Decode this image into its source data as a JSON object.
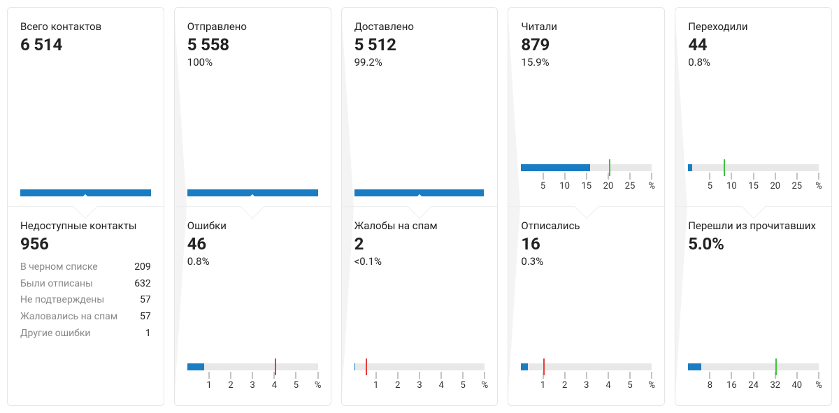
{
  "columns": [
    {
      "top": {
        "title": "Всего контактов",
        "value": "6 514",
        "bar": {
          "fill_pct": 100
        }
      },
      "bottom": {
        "title": "Недоступные контакты",
        "value": "956",
        "items": [
          {
            "label": "В черном списке",
            "value": "209"
          },
          {
            "label": "Были отписаны",
            "value": "632"
          },
          {
            "label": "Не подтверждены",
            "value": "57"
          },
          {
            "label": "Жаловались на спам",
            "value": "57"
          },
          {
            "label": "Другие ошибки",
            "value": "1"
          }
        ]
      }
    },
    {
      "top": {
        "title": "Отправлено",
        "value": "5 558",
        "percent": "100%",
        "bar": {
          "fill_pct": 100
        }
      },
      "bottom": {
        "title": "Ошибки",
        "value": "46",
        "percent": "0.8%",
        "bar": {
          "fill_pct": 13,
          "marker_red_pct": 67,
          "ticks": [
            {
              "pos_pct": 16.7,
              "label": "1"
            },
            {
              "pos_pct": 33.3,
              "label": "2"
            },
            {
              "pos_pct": 50.0,
              "label": "3"
            },
            {
              "pos_pct": 66.7,
              "label": "4"
            },
            {
              "pos_pct": 83.3,
              "label": "5"
            },
            {
              "pos_pct": 100,
              "label": "%"
            }
          ]
        }
      }
    },
    {
      "top": {
        "title": "Доставлено",
        "value": "5 512",
        "percent": "99.2%",
        "bar": {
          "fill_pct": 99.2
        }
      },
      "bottom": {
        "title": "Жалобы на спам",
        "value": "2",
        "percent": "<0.1%",
        "bar": {
          "fill_pct": 1,
          "marker_red_pct": 9,
          "ticks": [
            {
              "pos_pct": 16.7,
              "label": "1"
            },
            {
              "pos_pct": 33.3,
              "label": "2"
            },
            {
              "pos_pct": 50.0,
              "label": "3"
            },
            {
              "pos_pct": 66.7,
              "label": "4"
            },
            {
              "pos_pct": 83.3,
              "label": "5"
            },
            {
              "pos_pct": 100,
              "label": "%"
            }
          ]
        }
      }
    },
    {
      "top": {
        "title": "Читали",
        "value": "879",
        "percent": "15.9%",
        "bar": {
          "fill_pct": 53,
          "marker_green_pct": 67,
          "ticks": [
            {
              "pos_pct": 16.7,
              "label": "5"
            },
            {
              "pos_pct": 33.3,
              "label": "10"
            },
            {
              "pos_pct": 50.0,
              "label": "15"
            },
            {
              "pos_pct": 66.7,
              "label": "20"
            },
            {
              "pos_pct": 83.3,
              "label": "25"
            },
            {
              "pos_pct": 100,
              "label": "%"
            }
          ]
        }
      },
      "bottom": {
        "title": "Отписались",
        "value": "16",
        "percent": "0.3%",
        "bar": {
          "fill_pct": 5,
          "marker_red_pct": 17,
          "ticks": [
            {
              "pos_pct": 16.7,
              "label": "1"
            },
            {
              "pos_pct": 33.3,
              "label": "2"
            },
            {
              "pos_pct": 50.0,
              "label": "3"
            },
            {
              "pos_pct": 66.7,
              "label": "4"
            },
            {
              "pos_pct": 83.3,
              "label": "5"
            },
            {
              "pos_pct": 100,
              "label": "%"
            }
          ]
        }
      }
    },
    {
      "top": {
        "title": "Переходили",
        "value": "44",
        "percent": "0.8%",
        "bar": {
          "fill_pct": 3,
          "marker_green_pct": 27,
          "ticks": [
            {
              "pos_pct": 16.7,
              "label": "5"
            },
            {
              "pos_pct": 33.3,
              "label": "10"
            },
            {
              "pos_pct": 50.0,
              "label": "15"
            },
            {
              "pos_pct": 66.7,
              "label": "20"
            },
            {
              "pos_pct": 83.3,
              "label": "25"
            },
            {
              "pos_pct": 100,
              "label": "%"
            }
          ]
        }
      },
      "bottom": {
        "title": "Перешли из прочитавших",
        "percent": "5.0%",
        "bar": {
          "fill_pct": 10,
          "marker_green_pct": 67,
          "ticks": [
            {
              "pos_pct": 16.7,
              "label": "8"
            },
            {
              "pos_pct": 33.3,
              "label": "16"
            },
            {
              "pos_pct": 50.0,
              "label": "24"
            },
            {
              "pos_pct": 66.7,
              "label": "32"
            },
            {
              "pos_pct": 83.3,
              "label": "40"
            },
            {
              "pos_pct": 100,
              "label": "%"
            }
          ]
        }
      }
    }
  ],
  "chart_data": [
    {
      "type": "bar",
      "title": "Всего контактов",
      "values": [
        6514
      ],
      "note": "full bar, no axis"
    },
    {
      "type": "bar",
      "title": "Отправлено",
      "values": [
        5558
      ],
      "percent": 100,
      "note": "full bar, no axis"
    },
    {
      "type": "bar",
      "title": "Доставлено",
      "values": [
        5512
      ],
      "percent": 99.2,
      "note": "no axis"
    },
    {
      "type": "bar",
      "title": "Читали",
      "values": [
        879
      ],
      "percent": 15.9,
      "xticks": [
        5,
        10,
        15,
        20,
        25
      ],
      "xunit": "%",
      "target_marker": 20,
      "marker_color": "green"
    },
    {
      "type": "bar",
      "title": "Переходили",
      "values": [
        44
      ],
      "percent": 0.8,
      "xticks": [
        5,
        10,
        15,
        20,
        25
      ],
      "xunit": "%",
      "target_marker": 8,
      "marker_color": "green"
    },
    {
      "type": "bar",
      "title": "Ошибки",
      "values": [
        46
      ],
      "percent": 0.8,
      "xticks": [
        1,
        2,
        3,
        4,
        5
      ],
      "xunit": "%",
      "target_marker": 4,
      "marker_color": "red"
    },
    {
      "type": "bar",
      "title": "Жалобы на спам",
      "values": [
        2
      ],
      "percent_text": "<0.1%",
      "xticks": [
        1,
        2,
        3,
        4,
        5
      ],
      "xunit": "%",
      "target_marker": 0.5,
      "marker_color": "red"
    },
    {
      "type": "bar",
      "title": "Отписались",
      "values": [
        16
      ],
      "percent": 0.3,
      "xticks": [
        1,
        2,
        3,
        4,
        5
      ],
      "xunit": "%",
      "target_marker": 1,
      "marker_color": "red"
    },
    {
      "type": "bar",
      "title": "Перешли из прочитавших",
      "percent": 5.0,
      "xticks": [
        8,
        16,
        24,
        32,
        40
      ],
      "xunit": "%",
      "target_marker": 32,
      "marker_color": "green"
    },
    {
      "type": "table",
      "title": "Недоступные контакты",
      "total": 956,
      "categories": [
        "В черном списке",
        "Были отписаны",
        "Не подтверждены",
        "Жаловались на спам",
        "Другие ошибки"
      ],
      "values": [
        209,
        632,
        57,
        57,
        1
      ]
    }
  ]
}
